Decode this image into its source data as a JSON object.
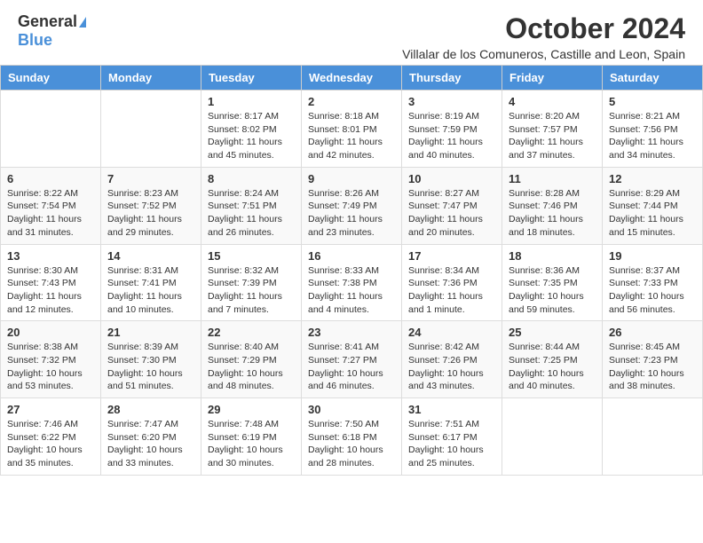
{
  "header": {
    "logo_general": "General",
    "logo_blue": "Blue",
    "month_title": "October 2024",
    "subtitle": "Villalar de los Comuneros, Castille and Leon, Spain"
  },
  "days_of_week": [
    "Sunday",
    "Monday",
    "Tuesday",
    "Wednesday",
    "Thursday",
    "Friday",
    "Saturday"
  ],
  "weeks": [
    [
      {
        "day": "",
        "content": ""
      },
      {
        "day": "",
        "content": ""
      },
      {
        "day": "1",
        "content": "Sunrise: 8:17 AM\nSunset: 8:02 PM\nDaylight: 11 hours and 45 minutes."
      },
      {
        "day": "2",
        "content": "Sunrise: 8:18 AM\nSunset: 8:01 PM\nDaylight: 11 hours and 42 minutes."
      },
      {
        "day": "3",
        "content": "Sunrise: 8:19 AM\nSunset: 7:59 PM\nDaylight: 11 hours and 40 minutes."
      },
      {
        "day": "4",
        "content": "Sunrise: 8:20 AM\nSunset: 7:57 PM\nDaylight: 11 hours and 37 minutes."
      },
      {
        "day": "5",
        "content": "Sunrise: 8:21 AM\nSunset: 7:56 PM\nDaylight: 11 hours and 34 minutes."
      }
    ],
    [
      {
        "day": "6",
        "content": "Sunrise: 8:22 AM\nSunset: 7:54 PM\nDaylight: 11 hours and 31 minutes."
      },
      {
        "day": "7",
        "content": "Sunrise: 8:23 AM\nSunset: 7:52 PM\nDaylight: 11 hours and 29 minutes."
      },
      {
        "day": "8",
        "content": "Sunrise: 8:24 AM\nSunset: 7:51 PM\nDaylight: 11 hours and 26 minutes."
      },
      {
        "day": "9",
        "content": "Sunrise: 8:26 AM\nSunset: 7:49 PM\nDaylight: 11 hours and 23 minutes."
      },
      {
        "day": "10",
        "content": "Sunrise: 8:27 AM\nSunset: 7:47 PM\nDaylight: 11 hours and 20 minutes."
      },
      {
        "day": "11",
        "content": "Sunrise: 8:28 AM\nSunset: 7:46 PM\nDaylight: 11 hours and 18 minutes."
      },
      {
        "day": "12",
        "content": "Sunrise: 8:29 AM\nSunset: 7:44 PM\nDaylight: 11 hours and 15 minutes."
      }
    ],
    [
      {
        "day": "13",
        "content": "Sunrise: 8:30 AM\nSunset: 7:43 PM\nDaylight: 11 hours and 12 minutes."
      },
      {
        "day": "14",
        "content": "Sunrise: 8:31 AM\nSunset: 7:41 PM\nDaylight: 11 hours and 10 minutes."
      },
      {
        "day": "15",
        "content": "Sunrise: 8:32 AM\nSunset: 7:39 PM\nDaylight: 11 hours and 7 minutes."
      },
      {
        "day": "16",
        "content": "Sunrise: 8:33 AM\nSunset: 7:38 PM\nDaylight: 11 hours and 4 minutes."
      },
      {
        "day": "17",
        "content": "Sunrise: 8:34 AM\nSunset: 7:36 PM\nDaylight: 11 hours and 1 minute."
      },
      {
        "day": "18",
        "content": "Sunrise: 8:36 AM\nSunset: 7:35 PM\nDaylight: 10 hours and 59 minutes."
      },
      {
        "day": "19",
        "content": "Sunrise: 8:37 AM\nSunset: 7:33 PM\nDaylight: 10 hours and 56 minutes."
      }
    ],
    [
      {
        "day": "20",
        "content": "Sunrise: 8:38 AM\nSunset: 7:32 PM\nDaylight: 10 hours and 53 minutes."
      },
      {
        "day": "21",
        "content": "Sunrise: 8:39 AM\nSunset: 7:30 PM\nDaylight: 10 hours and 51 minutes."
      },
      {
        "day": "22",
        "content": "Sunrise: 8:40 AM\nSunset: 7:29 PM\nDaylight: 10 hours and 48 minutes."
      },
      {
        "day": "23",
        "content": "Sunrise: 8:41 AM\nSunset: 7:27 PM\nDaylight: 10 hours and 46 minutes."
      },
      {
        "day": "24",
        "content": "Sunrise: 8:42 AM\nSunset: 7:26 PM\nDaylight: 10 hours and 43 minutes."
      },
      {
        "day": "25",
        "content": "Sunrise: 8:44 AM\nSunset: 7:25 PM\nDaylight: 10 hours and 40 minutes."
      },
      {
        "day": "26",
        "content": "Sunrise: 8:45 AM\nSunset: 7:23 PM\nDaylight: 10 hours and 38 minutes."
      }
    ],
    [
      {
        "day": "27",
        "content": "Sunrise: 7:46 AM\nSunset: 6:22 PM\nDaylight: 10 hours and 35 minutes."
      },
      {
        "day": "28",
        "content": "Sunrise: 7:47 AM\nSunset: 6:20 PM\nDaylight: 10 hours and 33 minutes."
      },
      {
        "day": "29",
        "content": "Sunrise: 7:48 AM\nSunset: 6:19 PM\nDaylight: 10 hours and 30 minutes."
      },
      {
        "day": "30",
        "content": "Sunrise: 7:50 AM\nSunset: 6:18 PM\nDaylight: 10 hours and 28 minutes."
      },
      {
        "day": "31",
        "content": "Sunrise: 7:51 AM\nSunset: 6:17 PM\nDaylight: 10 hours and 25 minutes."
      },
      {
        "day": "",
        "content": ""
      },
      {
        "day": "",
        "content": ""
      }
    ]
  ]
}
